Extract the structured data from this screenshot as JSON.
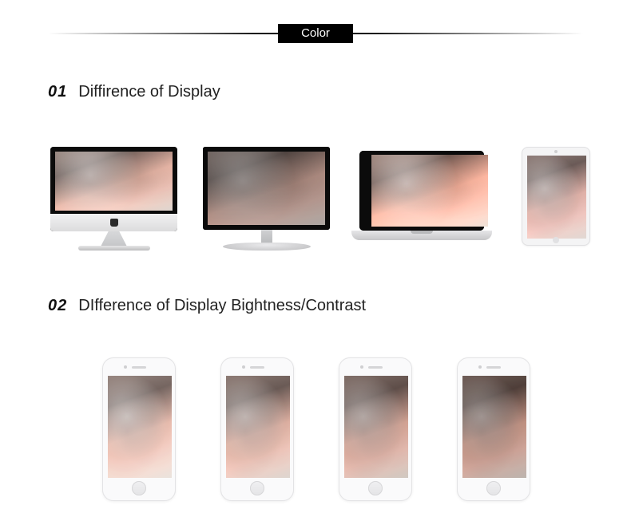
{
  "header": {
    "label": "Color"
  },
  "sections": [
    {
      "number": "01",
      "title": "Diffirence of Display"
    },
    {
      "number": "02",
      "title": "DIfference of Display Bightness/Contrast"
    }
  ],
  "row1_devices": [
    {
      "kind": "imac",
      "variation": "normal"
    },
    {
      "kind": "monitor",
      "variation": "darker"
    },
    {
      "kind": "laptop",
      "variation": "vivid"
    },
    {
      "kind": "tablet",
      "variation": "cool"
    }
  ],
  "row2_phones": [
    {
      "variation": "lighter-low-contrast"
    },
    {
      "variation": "normal"
    },
    {
      "variation": "slightly-darker"
    },
    {
      "variation": "darker-high-contrast"
    }
  ],
  "colors": {
    "header_bg": "#000000",
    "header_fg": "#ffffff",
    "text": "#111111"
  }
}
